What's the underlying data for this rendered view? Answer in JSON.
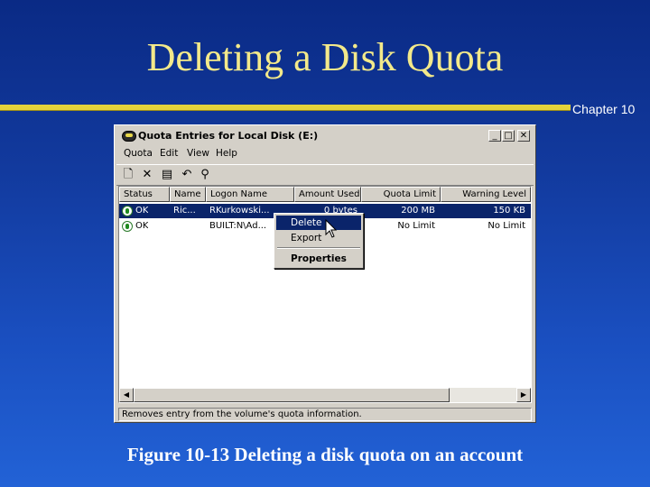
{
  "slide": {
    "title": "Deleting a Disk Quota",
    "chapter": "Chapter 10",
    "caption": "Figure 10-13  Deleting a disk quota on an account"
  },
  "window": {
    "title": "Quota Entries for Local Disk (E:)",
    "controls": [
      "_",
      "□",
      "✕"
    ],
    "menu": [
      "Quota",
      "Edit",
      "View",
      "Help"
    ],
    "toolbar_icons": [
      "new-entry-icon",
      "delete-icon",
      "properties-icon",
      "undo-icon",
      "find-icon"
    ],
    "columns": [
      "Status",
      "Name",
      "Logon Name",
      "Amount Used",
      "Quota Limit",
      "Warning Level"
    ],
    "rows": [
      {
        "status": "OK",
        "name": "Ric...",
        "logon": "RKurkowski...",
        "amount": "0 bytes",
        "limit": "200 MB",
        "warning": "150 KB",
        "selected": true
      },
      {
        "status": "OK",
        "name": "",
        "logon": "BUILT:N\\Ad...",
        "amount": "",
        "limit": "No Limit",
        "warning": "No Limit",
        "selected": false
      }
    ],
    "statusbar": "Removes entry from the volume's quota information."
  },
  "context_menu": {
    "items": [
      "Delete",
      "Export",
      "Properties"
    ],
    "highlighted": "Delete"
  },
  "colors": {
    "title": "#f3e98a",
    "rule": "#e4d23a",
    "selection": "#0a246a"
  }
}
